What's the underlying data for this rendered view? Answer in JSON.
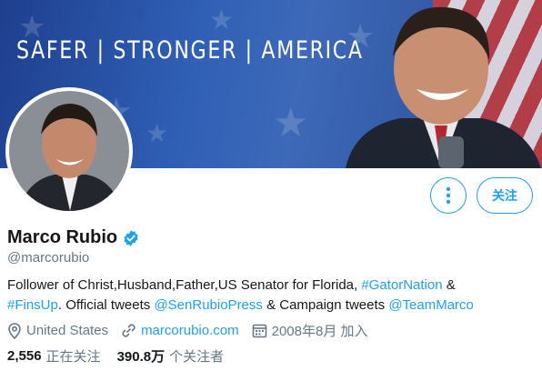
{
  "banner": {
    "slogan": "SAFER | STRONGER | AMERICA"
  },
  "profile": {
    "name": "Marco Rubio",
    "handle": "@marcorubio",
    "follow_label": "关注",
    "bio": {
      "t1": "Follower of Christ,Husband,Father,US Senator for Florida, ",
      "l1": "#GatorNation",
      "t2": " & ",
      "l2": "#FinsUp",
      "t3": ". Official tweets ",
      "l3": "@SenRubioPress",
      "t4": " & Campaign tweets ",
      "l4": "@TeamMarco"
    },
    "location": "United States",
    "website": "marcorubio.com",
    "joined": "2008年8月 加入",
    "following_count": "2,556",
    "following_label": "正在关注",
    "followers_count": "390.8万",
    "followers_label": "个关注者"
  },
  "icons": {
    "more": "vertical-dots-icon",
    "verified": "verified-badge-icon",
    "location": "location-pin-icon",
    "website": "link-icon",
    "joined": "calendar-icon"
  },
  "colors": {
    "accent": "#1da1f2",
    "secondary_text": "#657786",
    "banner": "#2f5fb5"
  }
}
